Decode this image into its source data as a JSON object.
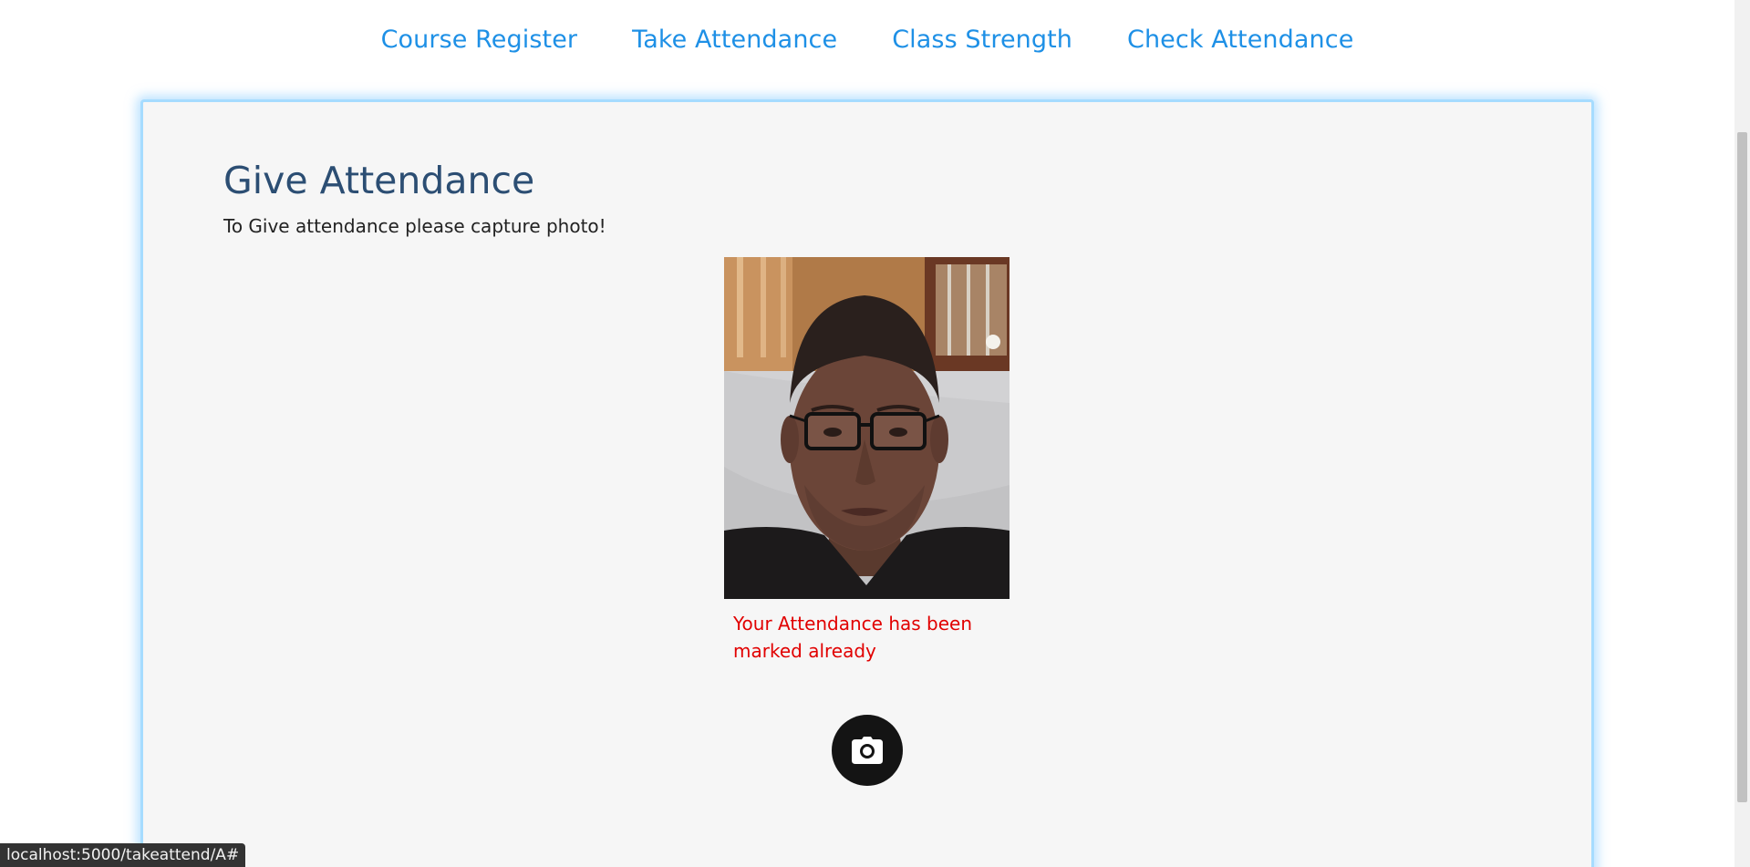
{
  "nav": {
    "items": [
      {
        "label": "Course Register"
      },
      {
        "label": "Take Attendance"
      },
      {
        "label": "Class Strength"
      },
      {
        "label": "Check Attendance"
      }
    ]
  },
  "card": {
    "title": "Give Attendance",
    "subtitle": "To Give attendance please capture photo!",
    "status_message": "Your Attendance has been marked already",
    "capture_icon": "camera-icon"
  },
  "status_bar": {
    "url": "localhost:5000/takeattend/A#"
  },
  "colors": {
    "nav_link": "#1e90e6",
    "title": "#2c4e73",
    "error": "#e10000",
    "card_bg": "#f6f6f6",
    "card_border": "#a6dcff"
  }
}
